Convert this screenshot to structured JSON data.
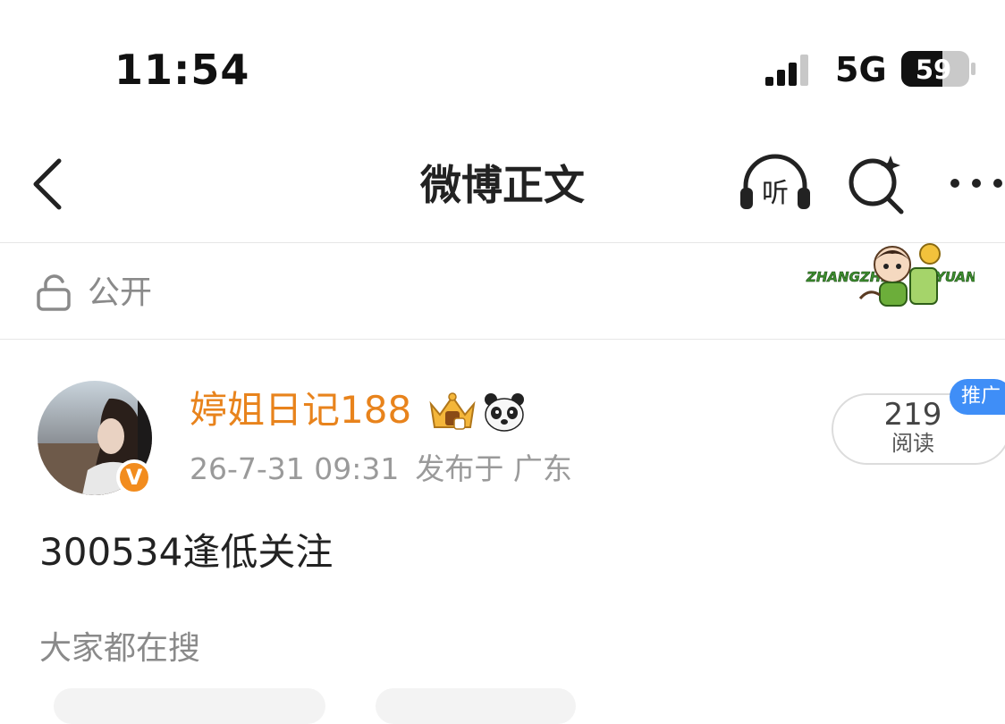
{
  "status_bar": {
    "time": "11:54",
    "network": "5G",
    "battery": "59"
  },
  "nav": {
    "title": "微博正文",
    "listen_label": "听"
  },
  "visibility": {
    "label": "公开",
    "sticker": {
      "text_left": "ZHANGZHE",
      "text_right": "YUAN"
    }
  },
  "post": {
    "author": "婷姐日记188",
    "date": "26-7-31 09:31",
    "published_from": "发布于 广东",
    "verified_badge": "V",
    "reads": {
      "count": "219",
      "label": "阅读"
    },
    "promo_badge": "推广",
    "content": "300534逢低关注"
  },
  "related": {
    "title": "大家都在搜"
  },
  "colors": {
    "author": "#e8831c",
    "verified": "#f28c1e",
    "promo": "#3f8ef7",
    "muted": "#8a8a8a"
  }
}
